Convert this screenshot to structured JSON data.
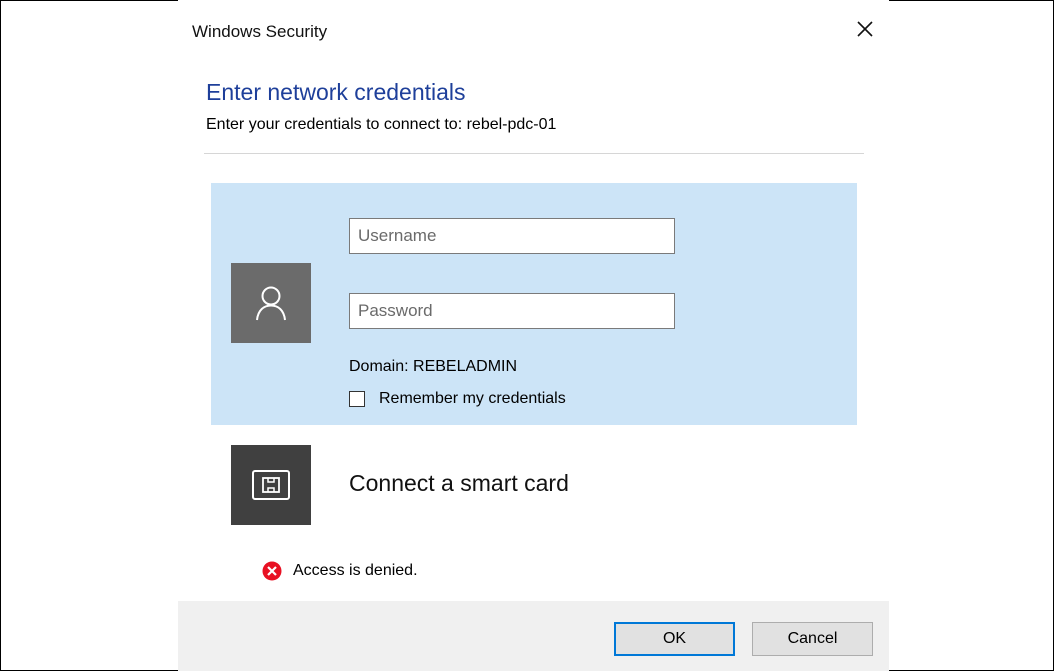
{
  "window": {
    "title": "Windows Security",
    "close_icon": "close-icon"
  },
  "header": {
    "heading": "Enter network credentials",
    "subheading": "Enter your credentials to connect to: rebel-pdc-01"
  },
  "credentials": {
    "avatar_icon": "user-icon",
    "username_placeholder": "Username",
    "username_value": "",
    "password_placeholder": "Password",
    "password_value": "",
    "domain_text": "Domain: REBELADMIN",
    "remember_label": "Remember my credentials",
    "remember_checked": false
  },
  "smart_card": {
    "icon": "smart-card-icon",
    "label": "Connect a smart card"
  },
  "error": {
    "icon": "error-icon",
    "message": "Access is denied."
  },
  "buttons": {
    "ok_label": "OK",
    "cancel_label": "Cancel"
  },
  "colors": {
    "heading": "#1e3f9a",
    "selected_tile": "#cce4f7",
    "avatar_bg": "#6b6b6b",
    "smart_card_bg": "#404040",
    "error_red": "#e81123",
    "footer_bg": "#f0f0f0",
    "default_button_border": "#0078d7"
  }
}
